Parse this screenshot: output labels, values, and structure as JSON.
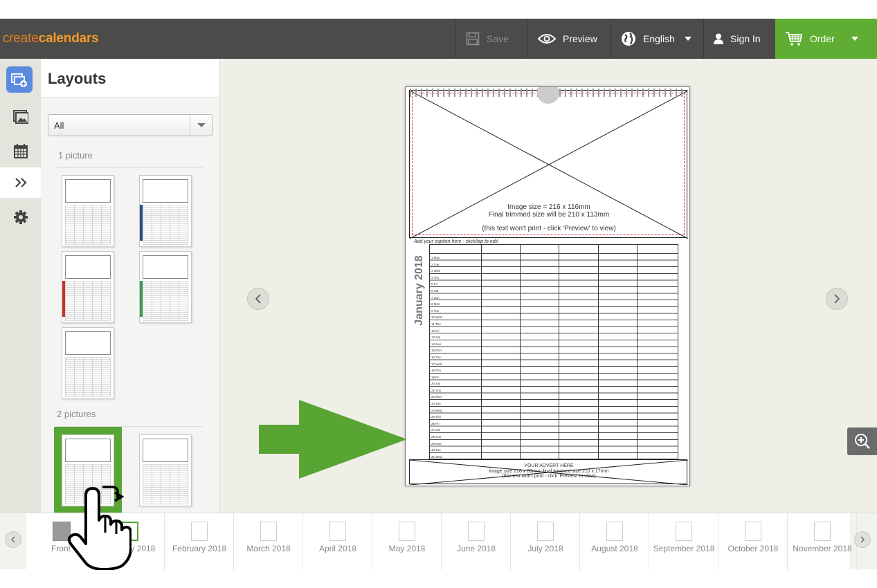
{
  "app": {
    "brand_part1": "create",
    "brand_part2": "calendars"
  },
  "toolbar": {
    "save_label": "Save",
    "preview_label": "Preview",
    "language_label": "English",
    "signin_label": "Sign In",
    "order_label": "Order",
    "order_color": "#5fae33"
  },
  "rail": {
    "items": [
      "add-photos-icon",
      "photos-icon",
      "calendar-icon",
      "layouts-icon",
      "settings-icon"
    ],
    "active": "layouts-icon"
  },
  "panel": {
    "title": "Layouts",
    "filter_value": "All",
    "section_1": "1 picture",
    "section_2": "2 pictures"
  },
  "page": {
    "image_size": "Image size = 216 x 116mm",
    "trimmed_size": "Final trimmed size will be 210 x 113mm",
    "image_note": "(this text won't print - click 'Preview' to view)",
    "caption": "Add your caption here - click/tap to edit",
    "month_title": "January 2018",
    "days": [
      "1 Mon",
      "2 Tue",
      "3 Wed",
      "4 Thu",
      "5 Fri",
      "6 Sat",
      "7 Sun",
      "8 Mon",
      "9 Tue",
      "10 Wed",
      "11 Thu",
      "12 Fri",
      "13 Sat",
      "14 Sun",
      "15 Mon",
      "16 Tue",
      "17 Wed",
      "18 Thu",
      "19 Fri",
      "20 Sat",
      "21 Sun",
      "22 Mon",
      "23 Tue",
      "24 Wed",
      "25 Thu",
      "26 Fri",
      "27 Sat",
      "28 Sun",
      "29 Mon",
      "30 Tue",
      "31 Wed"
    ],
    "advert_title": "YOUR ADVERT HERE",
    "advert_size": "image size 216 x 20mm, final trimmed size 210 x 17mm",
    "advert_note": "(this text won't print - click 'Preview' to view)"
  },
  "strip": {
    "items": [
      "Front",
      "January 2018",
      "February 2018",
      "March 2018",
      "April 2018",
      "May 2018",
      "June 2018",
      "July 2018",
      "August 2018",
      "September 2018",
      "October 2018",
      "November 2018"
    ],
    "current": "January 2018"
  },
  "overlay": {
    "arrow_color": "#58a534",
    "selection_color": "#58a534"
  }
}
